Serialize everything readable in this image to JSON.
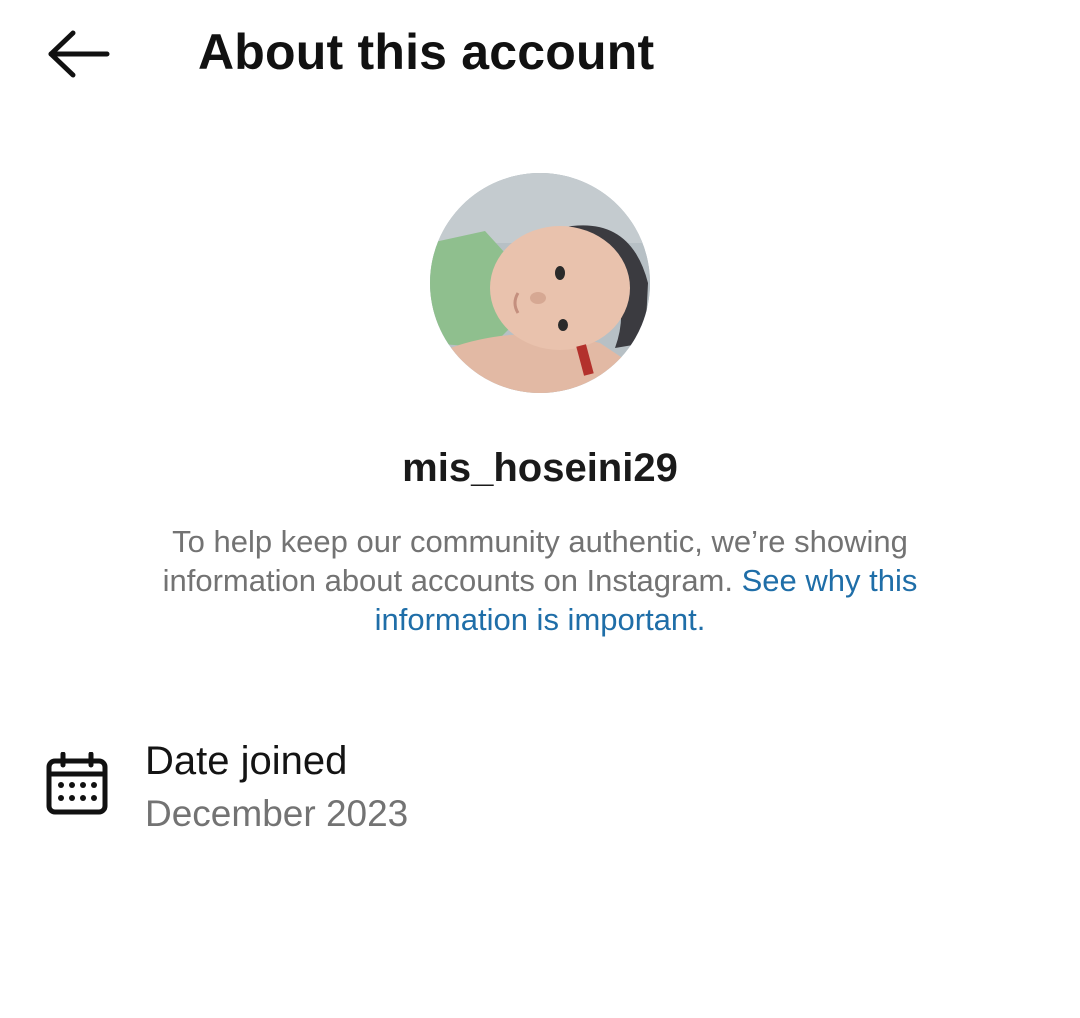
{
  "header": {
    "back_icon": "arrow-left-icon",
    "title": "About this account"
  },
  "profile": {
    "avatar_description": "profile-photo",
    "username": "mis_hoseini29"
  },
  "info": {
    "text": "To help keep our community authentic, we’re showing information about accounts on Instagram.",
    "link": "See why this information is important."
  },
  "details": [
    {
      "icon": "calendar-icon",
      "label": "Date joined",
      "value": "December 2023"
    }
  ],
  "colors": {
    "text_primary": "#111111",
    "text_secondary": "#737373",
    "link": "#1f6ea8",
    "background": "#ffffff"
  }
}
